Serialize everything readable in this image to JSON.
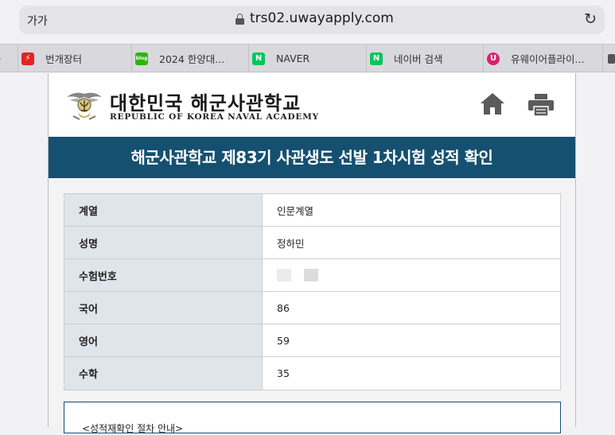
{
  "browser": {
    "text_size_label": "가가",
    "url": "trs02.uwayapply.com",
    "tabs": [
      {
        "label": "",
        "icon": "partial-tab-icon"
      },
      {
        "label": "번개장터",
        "icon": "bolt-icon",
        "color": "#e32424"
      },
      {
        "label": "2024 한양대...",
        "icon": "blog-icon",
        "color": "#2db400"
      },
      {
        "label": "NAVER",
        "icon": "naver-icon",
        "color": "#03c75a",
        "glyph": "N"
      },
      {
        "label": "네이버 검색",
        "icon": "naver-icon",
        "color": "#03c75a",
        "glyph": "N"
      },
      {
        "label": "유웨이어플라이...",
        "icon": "uway-icon",
        "color": "#d6246e",
        "glyph": "U"
      }
    ]
  },
  "header": {
    "brand_ko": "대한민국 해군사관학교",
    "brand_en": "REPUBLIC OF KOREA NAVAL ACADEMY"
  },
  "banner": {
    "title": "해군사관학교 제83기 사관생도 선발 1차시험 성적 확인"
  },
  "results": [
    {
      "label": "계열",
      "value": "인문계열"
    },
    {
      "label": "성명",
      "value": "정하민"
    },
    {
      "label": "수험번호",
      "value": ""
    },
    {
      "label": "국어",
      "value": "86"
    },
    {
      "label": "영어",
      "value": "59"
    },
    {
      "label": "수학",
      "value": "35"
    }
  ],
  "notice": {
    "text": "<성적재확인 절차 안내>"
  },
  "colors": {
    "banner": "#155070",
    "header_cell": "#dfe5ea"
  }
}
